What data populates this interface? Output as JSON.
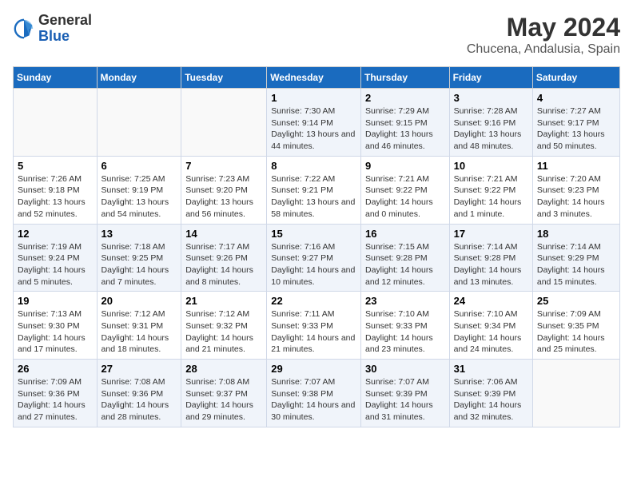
{
  "header": {
    "logo_general": "General",
    "logo_blue": "Blue",
    "title": "May 2024",
    "subtitle": "Chucena, Andalusia, Spain"
  },
  "days_of_week": [
    "Sunday",
    "Monday",
    "Tuesday",
    "Wednesday",
    "Thursday",
    "Friday",
    "Saturday"
  ],
  "weeks": [
    [
      {
        "day": "",
        "sunrise": "",
        "sunset": "",
        "daylight": ""
      },
      {
        "day": "",
        "sunrise": "",
        "sunset": "",
        "daylight": ""
      },
      {
        "day": "",
        "sunrise": "",
        "sunset": "",
        "daylight": ""
      },
      {
        "day": "1",
        "sunrise": "Sunrise: 7:30 AM",
        "sunset": "Sunset: 9:14 PM",
        "daylight": "Daylight: 13 hours and 44 minutes."
      },
      {
        "day": "2",
        "sunrise": "Sunrise: 7:29 AM",
        "sunset": "Sunset: 9:15 PM",
        "daylight": "Daylight: 13 hours and 46 minutes."
      },
      {
        "day": "3",
        "sunrise": "Sunrise: 7:28 AM",
        "sunset": "Sunset: 9:16 PM",
        "daylight": "Daylight: 13 hours and 48 minutes."
      },
      {
        "day": "4",
        "sunrise": "Sunrise: 7:27 AM",
        "sunset": "Sunset: 9:17 PM",
        "daylight": "Daylight: 13 hours and 50 minutes."
      }
    ],
    [
      {
        "day": "5",
        "sunrise": "Sunrise: 7:26 AM",
        "sunset": "Sunset: 9:18 PM",
        "daylight": "Daylight: 13 hours and 52 minutes."
      },
      {
        "day": "6",
        "sunrise": "Sunrise: 7:25 AM",
        "sunset": "Sunset: 9:19 PM",
        "daylight": "Daylight: 13 hours and 54 minutes."
      },
      {
        "day": "7",
        "sunrise": "Sunrise: 7:23 AM",
        "sunset": "Sunset: 9:20 PM",
        "daylight": "Daylight: 13 hours and 56 minutes."
      },
      {
        "day": "8",
        "sunrise": "Sunrise: 7:22 AM",
        "sunset": "Sunset: 9:21 PM",
        "daylight": "Daylight: 13 hours and 58 minutes."
      },
      {
        "day": "9",
        "sunrise": "Sunrise: 7:21 AM",
        "sunset": "Sunset: 9:22 PM",
        "daylight": "Daylight: 14 hours and 0 minutes."
      },
      {
        "day": "10",
        "sunrise": "Sunrise: 7:21 AM",
        "sunset": "Sunset: 9:22 PM",
        "daylight": "Daylight: 14 hours and 1 minute."
      },
      {
        "day": "11",
        "sunrise": "Sunrise: 7:20 AM",
        "sunset": "Sunset: 9:23 PM",
        "daylight": "Daylight: 14 hours and 3 minutes."
      }
    ],
    [
      {
        "day": "12",
        "sunrise": "Sunrise: 7:19 AM",
        "sunset": "Sunset: 9:24 PM",
        "daylight": "Daylight: 14 hours and 5 minutes."
      },
      {
        "day": "13",
        "sunrise": "Sunrise: 7:18 AM",
        "sunset": "Sunset: 9:25 PM",
        "daylight": "Daylight: 14 hours and 7 minutes."
      },
      {
        "day": "14",
        "sunrise": "Sunrise: 7:17 AM",
        "sunset": "Sunset: 9:26 PM",
        "daylight": "Daylight: 14 hours and 8 minutes."
      },
      {
        "day": "15",
        "sunrise": "Sunrise: 7:16 AM",
        "sunset": "Sunset: 9:27 PM",
        "daylight": "Daylight: 14 hours and 10 minutes."
      },
      {
        "day": "16",
        "sunrise": "Sunrise: 7:15 AM",
        "sunset": "Sunset: 9:28 PM",
        "daylight": "Daylight: 14 hours and 12 minutes."
      },
      {
        "day": "17",
        "sunrise": "Sunrise: 7:14 AM",
        "sunset": "Sunset: 9:28 PM",
        "daylight": "Daylight: 14 hours and 13 minutes."
      },
      {
        "day": "18",
        "sunrise": "Sunrise: 7:14 AM",
        "sunset": "Sunset: 9:29 PM",
        "daylight": "Daylight: 14 hours and 15 minutes."
      }
    ],
    [
      {
        "day": "19",
        "sunrise": "Sunrise: 7:13 AM",
        "sunset": "Sunset: 9:30 PM",
        "daylight": "Daylight: 14 hours and 17 minutes."
      },
      {
        "day": "20",
        "sunrise": "Sunrise: 7:12 AM",
        "sunset": "Sunset: 9:31 PM",
        "daylight": "Daylight: 14 hours and 18 minutes."
      },
      {
        "day": "21",
        "sunrise": "Sunrise: 7:12 AM",
        "sunset": "Sunset: 9:32 PM",
        "daylight": "Daylight: 14 hours and 21 minutes."
      },
      {
        "day": "22",
        "sunrise": "Sunrise: 7:11 AM",
        "sunset": "Sunset: 9:33 PM",
        "daylight": "Daylight: 14 hours and 21 minutes."
      },
      {
        "day": "23",
        "sunrise": "Sunrise: 7:10 AM",
        "sunset": "Sunset: 9:33 PM",
        "daylight": "Daylight: 14 hours and 23 minutes."
      },
      {
        "day": "24",
        "sunrise": "Sunrise: 7:10 AM",
        "sunset": "Sunset: 9:34 PM",
        "daylight": "Daylight: 14 hours and 24 minutes."
      },
      {
        "day": "25",
        "sunrise": "Sunrise: 7:09 AM",
        "sunset": "Sunset: 9:35 PM",
        "daylight": "Daylight: 14 hours and 25 minutes."
      }
    ],
    [
      {
        "day": "26",
        "sunrise": "Sunrise: 7:09 AM",
        "sunset": "Sunset: 9:36 PM",
        "daylight": "Daylight: 14 hours and 27 minutes."
      },
      {
        "day": "27",
        "sunrise": "Sunrise: 7:08 AM",
        "sunset": "Sunset: 9:36 PM",
        "daylight": "Daylight: 14 hours and 28 minutes."
      },
      {
        "day": "28",
        "sunrise": "Sunrise: 7:08 AM",
        "sunset": "Sunset: 9:37 PM",
        "daylight": "Daylight: 14 hours and 29 minutes."
      },
      {
        "day": "29",
        "sunrise": "Sunrise: 7:07 AM",
        "sunset": "Sunset: 9:38 PM",
        "daylight": "Daylight: 14 hours and 30 minutes."
      },
      {
        "day": "30",
        "sunrise": "Sunrise: 7:07 AM",
        "sunset": "Sunset: 9:39 PM",
        "daylight": "Daylight: 14 hours and 31 minutes."
      },
      {
        "day": "31",
        "sunrise": "Sunrise: 7:06 AM",
        "sunset": "Sunset: 9:39 PM",
        "daylight": "Daylight: 14 hours and 32 minutes."
      },
      {
        "day": "",
        "sunrise": "",
        "sunset": "",
        "daylight": ""
      }
    ]
  ]
}
